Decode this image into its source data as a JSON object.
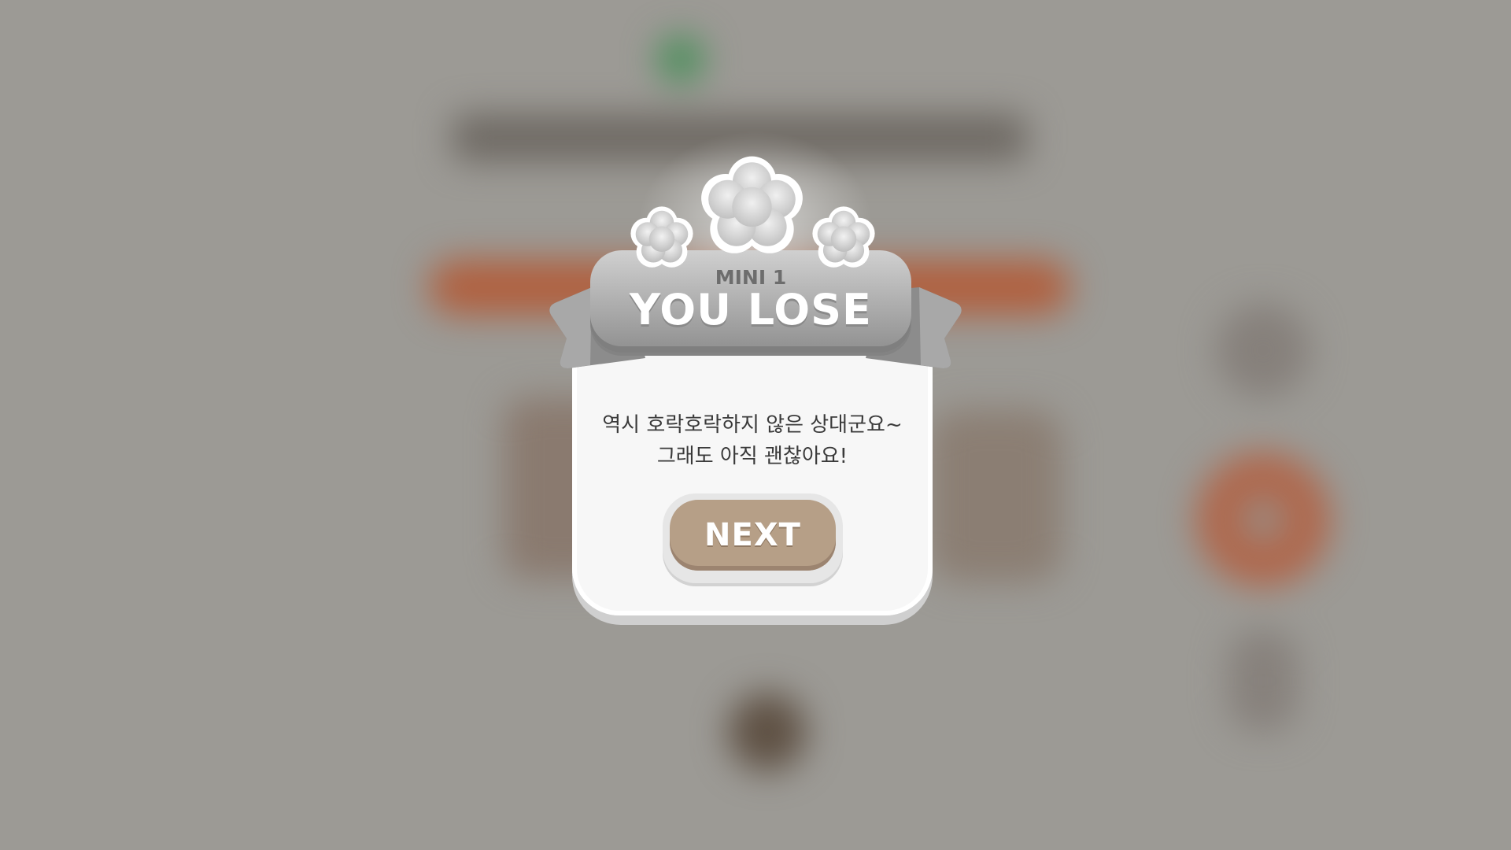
{
  "popup": {
    "stage_label": "MINI 1",
    "result_title": "YOU LOSE",
    "message_line1": "역시 호락호락하지 않은 상대군요~",
    "message_line2": "그래도 아직 괜찮아요!",
    "next_label": "NEXT"
  },
  "colors": {
    "banner": "#a9a9a9",
    "panel": "#f7f7f7",
    "next_button": "#b69f87",
    "background_orange": "#b0603f",
    "background_green": "#4a8f5a"
  },
  "icons": [
    "clover-icon-left",
    "clover-icon-center",
    "clover-icon-right"
  ]
}
